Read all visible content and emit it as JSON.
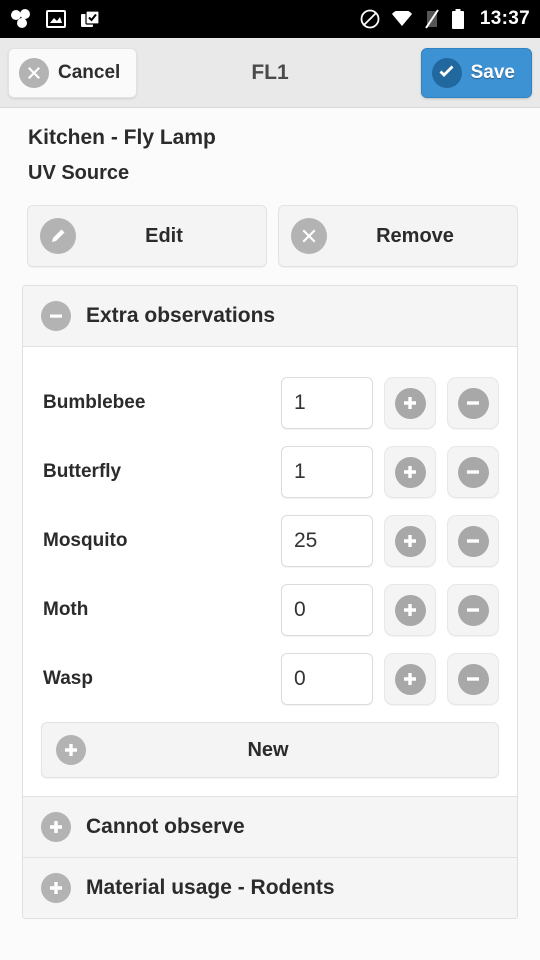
{
  "status_bar": {
    "time": "13:37",
    "left_icons": [
      "apps-cluster-icon",
      "image-icon",
      "clipboard-check-icon"
    ],
    "right_icons": [
      "do-not-disturb-icon",
      "wifi-icon",
      "signal-off-icon",
      "battery-icon"
    ]
  },
  "action_bar": {
    "cancel_label": "Cancel",
    "title": "FL1",
    "save_label": "Save",
    "save_color": "#3d92d4"
  },
  "header": {
    "title": "Kitchen - Fly Lamp",
    "subtitle": "UV Source"
  },
  "actions": [
    {
      "label": "Edit",
      "icon": "pencil-icon"
    },
    {
      "label": "Remove",
      "icon": "close-circle-icon"
    }
  ],
  "sections": [
    {
      "label": "Extra observations",
      "state": "expanded",
      "icon": "minus-circle-icon"
    },
    {
      "label": "Cannot observe",
      "state": "collapsed",
      "icon": "plus-circle-icon"
    },
    {
      "label": "Material usage - Rodents",
      "state": "collapsed",
      "icon": "plus-circle-icon"
    }
  ],
  "observations": [
    {
      "label": "Bumblebee",
      "value": "1"
    },
    {
      "label": "Butterfly",
      "value": "1"
    },
    {
      "label": "Mosquito",
      "value": "25"
    },
    {
      "label": "Moth",
      "value": "0"
    },
    {
      "label": "Wasp",
      "value": "0"
    }
  ],
  "new_button": {
    "label": "New",
    "icon": "plus-circle-icon"
  }
}
